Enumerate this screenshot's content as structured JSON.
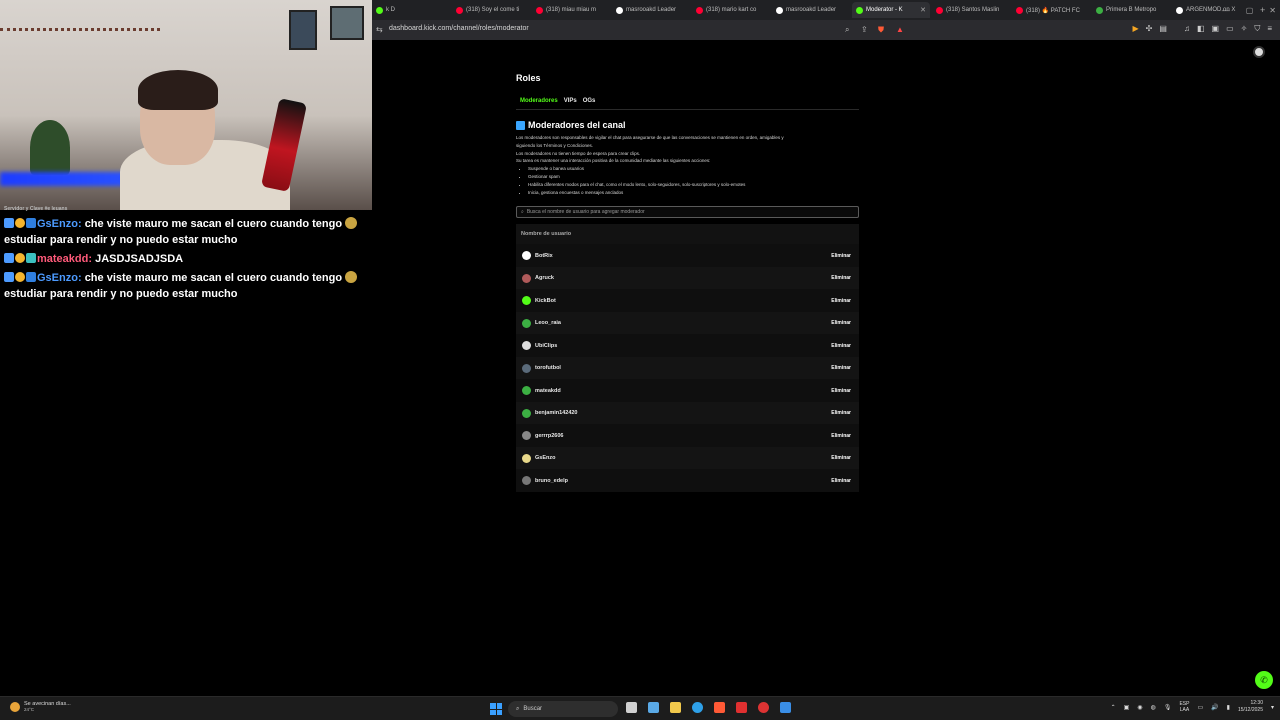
{
  "browser": {
    "tabs": [
      {
        "title": "k D",
        "color": "#53fc18",
        "active": false
      },
      {
        "title": "(318) Soy el come ti",
        "color": "#ff0033",
        "active": false
      },
      {
        "title": "(318) miau miau m",
        "color": "#ff0033",
        "active": false
      },
      {
        "title": "masrooakd Leader",
        "color": "#ffffff",
        "active": false
      },
      {
        "title": "(318) mario kart co",
        "color": "#ff0033",
        "active": false
      },
      {
        "title": "masrooakd Leader",
        "color": "#ffffff",
        "active": false
      },
      {
        "title": "Moderator - K",
        "color": "#53fc18",
        "active": true
      },
      {
        "title": "(318) Santos Maslin",
        "color": "#ff0033",
        "active": false
      },
      {
        "title": "(318) 🔥 PATCH FC",
        "color": "#ff0033",
        "active": false
      },
      {
        "title": "Primera B Metropo",
        "color": "#3cb043",
        "active": false
      },
      {
        "title": "ARGENMOD on X",
        "color": "#ffffff",
        "active": false
      }
    ],
    "url": "dashboard.kick.com/channel/roles/moderator"
  },
  "chat": {
    "cut_line": "Servidor y Clave #e leuans",
    "messages": [
      {
        "user": "GsEnzo",
        "user_color": "#4d9bff",
        "sep": ":",
        "text": "che viste mauro me sacan el cuero cuando tengo",
        "text2": "estudiar para rendir y no puedo estar mucho"
      },
      {
        "user": "mateakdd",
        "user_color": "#ff5a7a",
        "sep": ":",
        "text": "JASDJSADJSDA",
        "text2": ""
      },
      {
        "user": "GsEnzo",
        "user_color": "#4d9bff",
        "sep": ":",
        "text": "che viste mauro me sacan el cuero cuando tengo",
        "text2": "estudiar para rendir y no puedo estar mucho"
      }
    ]
  },
  "page": {
    "title": "Roles",
    "tabs": [
      "Moderadores",
      "VIPs",
      "OGs"
    ],
    "section_title": "Moderadores del canal",
    "desc_lines": [
      "Los moderadores son responsables de vigilar el chat para asegurarse de que las conversaciones se mantienen en orden, amigables y",
      "siguiendo los Términos y Condiciones.",
      "Los moderadores no tienen tiempo de espera para crear clips.",
      "Su tarea es mantener una interacción positiva de la comunidad mediante las siguientes acciones:"
    ],
    "bullets": [
      "Suspende o banea usuarios",
      "Gestionar spam",
      "Habilita diferentes modos para el chat, como el modo lento, solo-seguidores, solo-suscriptores y solo-emotes",
      "Inicia, gestiona encuestas o mensajes anclados"
    ],
    "search_placeholder": "Busca el nombre de usuario para agregar moderador",
    "column_header": "Nombre de usuario",
    "remove_label": "Eliminar",
    "moderators": [
      {
        "name": "BotRix",
        "color": "#ffffff"
      },
      {
        "name": "Agruck",
        "color": "#b05a5a"
      },
      {
        "name": "KickBot",
        "color": "#53fc18"
      },
      {
        "name": "Leoo_raia",
        "color": "#3cb043"
      },
      {
        "name": "UbiClips",
        "color": "#dddddd"
      },
      {
        "name": "torofutbol",
        "color": "#5a6a7a"
      },
      {
        "name": "mateakdd",
        "color": "#3cb043"
      },
      {
        "name": "benjamin142420",
        "color": "#3cb043"
      },
      {
        "name": "gerrrp2606",
        "color": "#888888"
      },
      {
        "name": "GsEnzo",
        "color": "#e8d88a"
      },
      {
        "name": "bruno_edelp",
        "color": "#777777"
      }
    ]
  },
  "taskbar": {
    "weather_text": "Se avecinan días...",
    "weather_temp": "24°C",
    "search_label": "Buscar",
    "lang_line1": "ESP",
    "lang_line2": "LAA",
    "time": "12:30",
    "date": "15/12/2025"
  }
}
